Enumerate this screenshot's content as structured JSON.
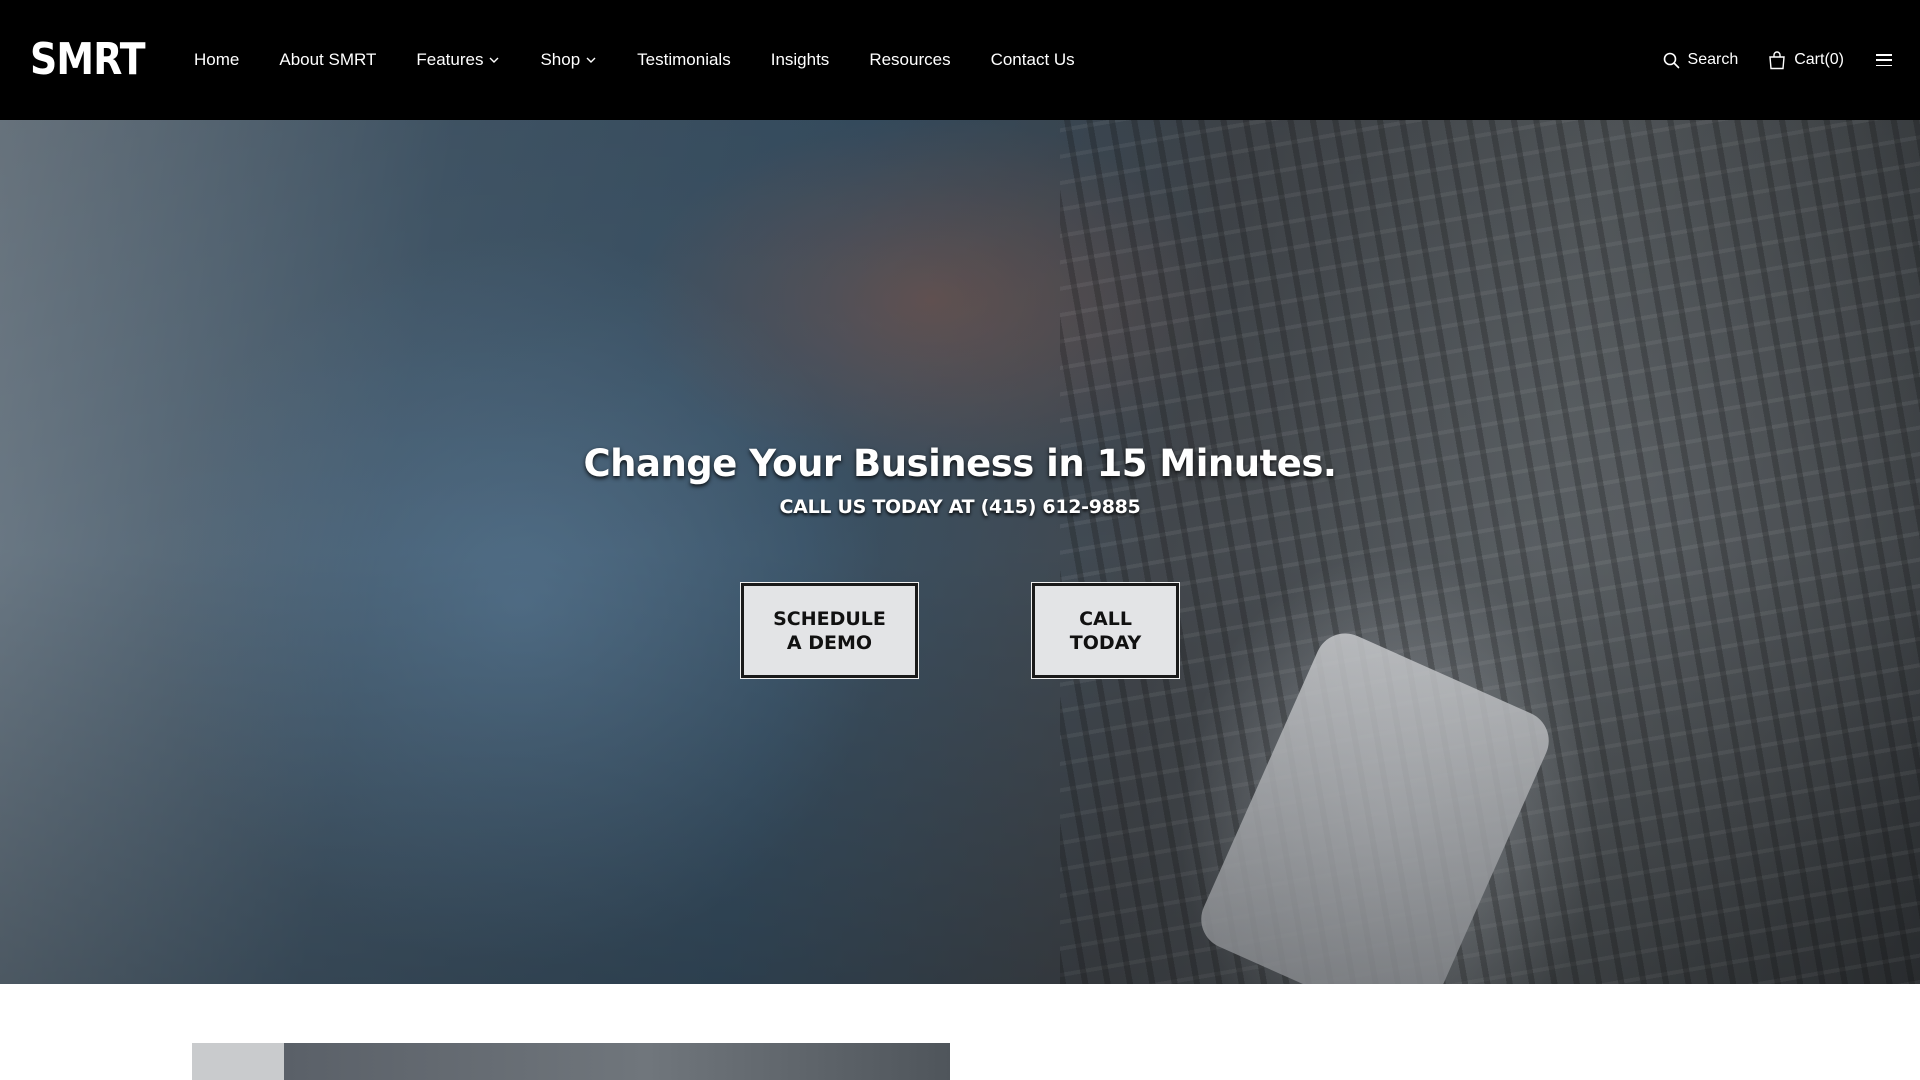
{
  "header": {
    "logo": "SMRT",
    "nav": [
      {
        "label": "Home",
        "dropdown": false
      },
      {
        "label": "About SMRT",
        "dropdown": false
      },
      {
        "label": "Features",
        "dropdown": true
      },
      {
        "label": "Shop",
        "dropdown": true
      },
      {
        "label": "Testimonials",
        "dropdown": false
      },
      {
        "label": "Insights",
        "dropdown": false
      },
      {
        "label": "Resources",
        "dropdown": false
      },
      {
        "label": "Contact Us",
        "dropdown": false
      }
    ],
    "search_label": "Search",
    "cart_label": "Cart(0)"
  },
  "hero": {
    "title": "Change Your Business in 15 Minutes.",
    "subtitle": "CALL US TODAY AT (415) 612-9885",
    "cta_demo_line1": "SCHEDULE",
    "cta_demo_line2": "A DEMO",
    "cta_call_line1": "CALL",
    "cta_call_line2": "TODAY"
  },
  "colors": {
    "header_bg": "#000000",
    "button_bg": "#e3e4e6",
    "text_light": "#ffffff"
  },
  "icons": [
    "search-icon",
    "shopping-bag-icon",
    "hamburger-menu-icon",
    "chevron-down-icon"
  ]
}
